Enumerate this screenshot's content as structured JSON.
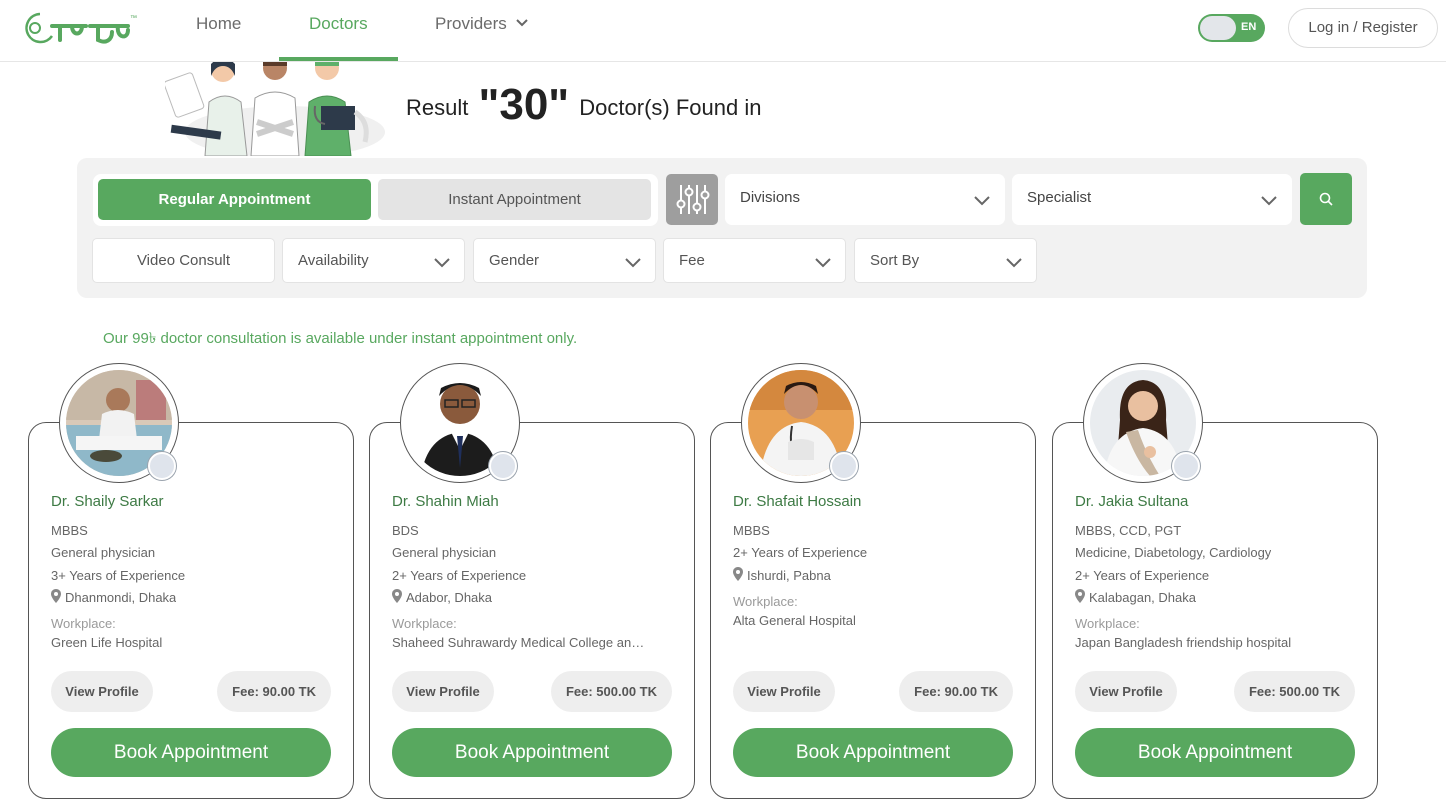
{
  "brand": {
    "logo_text": "শেবা",
    "accent_color": "#58a85f"
  },
  "nav": {
    "home": "Home",
    "doctors": "Doctors",
    "providers": "Providers",
    "lang": "EN",
    "login": "Log in / Register"
  },
  "hero": {
    "prefix": "Result",
    "count": "\"30\"",
    "suffix": "Doctor(s) Found in"
  },
  "filters": {
    "regular": "Regular Appointment",
    "instant": "Instant Appointment",
    "divisions": "Divisions",
    "specialist": "Specialist",
    "video_consult": "Video Consult",
    "availability": "Availability",
    "gender": "Gender",
    "fee": "Fee",
    "sort_by": "Sort By"
  },
  "notice": "Our 99৳ doctor consultation is available under instant appointment only.",
  "doctors": [
    {
      "name": "Dr. Shaily Sarkar",
      "degree": "MBBS",
      "specialty": "General physician",
      "experience": "3+ Years of Experience",
      "location": "Dhanmondi, Dhaka",
      "workplace_label": "Workplace:",
      "workplace": "Green Life Hospital",
      "view_profile": "View Profile",
      "fee": "Fee: 90.00 TK",
      "book": "Book Appointment"
    },
    {
      "name": "Dr. Shahin Miah",
      "degree": "BDS",
      "specialty": "General physician",
      "experience": "2+ Years of Experience",
      "location": "Adabor, Dhaka",
      "workplace_label": "Workplace:",
      "workplace": "Shaheed Suhrawardy Medical College and…",
      "view_profile": "View Profile",
      "fee": "Fee: 500.00 TK",
      "book": "Book Appointment"
    },
    {
      "name": "Dr. Shafait Hossain",
      "degree": "MBBS",
      "experience": "2+ Years of Experience",
      "location": "Ishurdi, Pabna",
      "workplace_label": "Workplace:",
      "workplace": "Alta General Hospital",
      "view_profile": "View Profile",
      "fee": "Fee: 90.00 TK",
      "book": "Book Appointment"
    },
    {
      "name": "Dr. Jakia Sultana",
      "degree": "MBBS, CCD, PGT",
      "specialty": "Medicine, Diabetology, Cardiology",
      "experience": "2+ Years of Experience",
      "location": "Kalabagan, Dhaka",
      "workplace_label": "Workplace:",
      "workplace": "Japan Bangladesh friendship hospital",
      "view_profile": "View Profile",
      "fee": "Fee: 500.00 TK",
      "book": "Book Appointment"
    }
  ]
}
